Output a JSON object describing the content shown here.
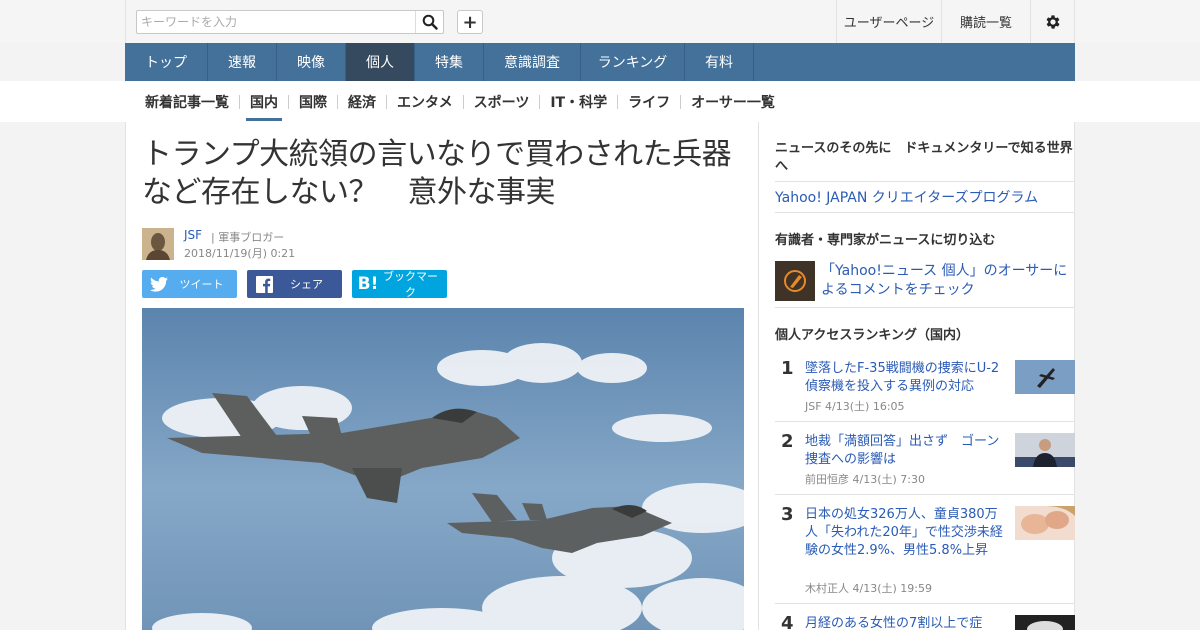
{
  "header": {
    "search_placeholder": "キーワードを入力",
    "user_page": "ユーザーページ",
    "subscriptions": "購読一覧"
  },
  "nav": [
    "トップ",
    "速報",
    "映像",
    "個人",
    "特集",
    "意識調査",
    "ランキング",
    "有料"
  ],
  "nav_active": "個人",
  "subnav": [
    "新着記事一覧",
    "国内",
    "国際",
    "経済",
    "エンタメ",
    "スポーツ",
    "IT・科学",
    "ライフ",
    "オーサー一覧"
  ],
  "subnav_active": "国内",
  "article": {
    "title": "トランプ大統領の言いなりで買わされた兵器など存在しない？　意外な事実",
    "author": "JSF",
    "role": "| 軍事ブロガー",
    "date": "2018/11/19(月) 0:21"
  },
  "share": {
    "tweet": "ツイート",
    "facebook": "シェア",
    "bookmark": "ブックマーク"
  },
  "sidebar": {
    "promo_head": "ニュースのその先に　ドキュメンタリーで知る世界へ",
    "promo_link": "Yahoo! JAPAN クリエイターズプログラム",
    "expert_head": "有識者・専門家がニュースに切り込む",
    "expert_link": "「Yahoo!ニュース 個人」のオーサーによるコメントをチェック",
    "ranking_head": "個人アクセスランキング（国内）",
    "ranking": [
      {
        "no": "1",
        "title": "墜落したF-35戦闘機の捜索にU-2偵察機を投入する異例の対応",
        "meta": "JSF  4/13(土) 16:05"
      },
      {
        "no": "2",
        "title": "地裁「満額回答」出さず　ゴーン捜査への影響は",
        "meta": "前田恒彦  4/13(土) 7:30"
      },
      {
        "no": "3",
        "title": "日本の処女326万人、童貞380万人「失われた20年」で性交渉未経験の女性2.9%、男性5.8%上昇",
        "meta": "木村正人  4/13(土) 19:59"
      },
      {
        "no": "4",
        "title": "月経のある女性の7割以上で症",
        "meta": ""
      }
    ]
  },
  "colors": {
    "nav": "#43719a",
    "nav_active": "#354a5e",
    "link": "#2a5bb5",
    "twitter": "#55acee",
    "facebook": "#3b5998",
    "hatena": "#00a4de"
  }
}
